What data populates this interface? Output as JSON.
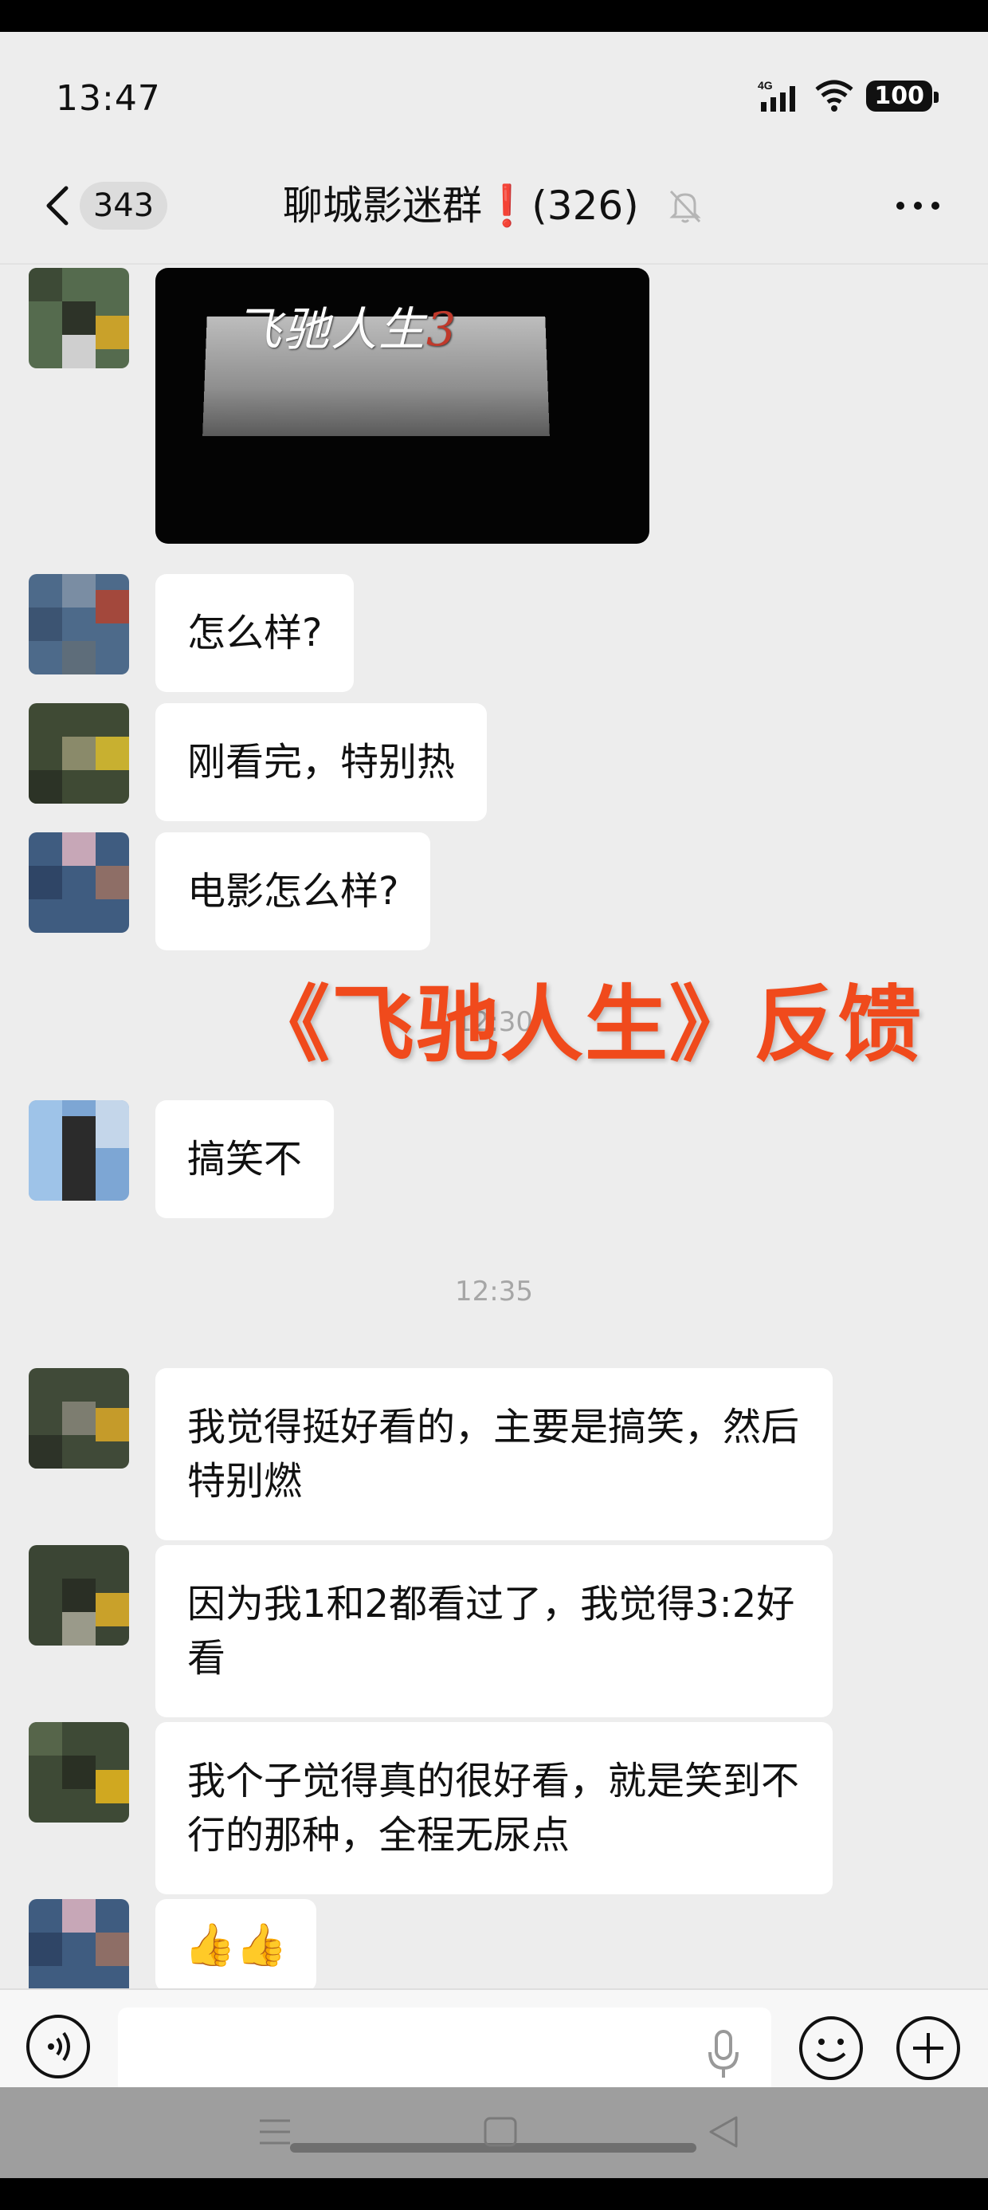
{
  "status_bar": {
    "time": "13:47",
    "network": "4G",
    "battery": "100"
  },
  "header": {
    "unread_count": "343",
    "title": "聊城影迷群❗(326)"
  },
  "image_message": {
    "movie_title": "飞驰人生",
    "movie_number": "3"
  },
  "messages": [
    {
      "text": "怎么样?"
    },
    {
      "text": "刚看完，特别热"
    },
    {
      "text": "电影怎么样?"
    },
    {
      "text": "搞笑不"
    },
    {
      "text": "我觉得挺好看的，主要是搞笑，然后特别燃"
    },
    {
      "text": "因为我1和2都看过了，我觉得3:2好看"
    },
    {
      "text": "我个子觉得真的很好看，就是笑到不行的那种，全程无尿点"
    },
    {
      "text": "👍👍"
    }
  ],
  "timestamps": {
    "obscured": "12:30",
    "second": "12:35"
  },
  "overlay_caption": "《飞驰人生》反馈",
  "input_bar": {
    "placeholder": ""
  },
  "colors": {
    "background": "#ededed",
    "bubble": "#ffffff",
    "caption_accent": "#f04a1c",
    "timestamp": "#a6a6a6",
    "nav_bar": "#9e9e9e"
  },
  "icons": [
    "back-arrow-icon",
    "mute-bell-icon",
    "more-dots-icon",
    "voice-icon",
    "mic-icon",
    "emoji-icon",
    "plus-icon",
    "nav-menu-icon",
    "nav-home-icon",
    "nav-back-icon"
  ]
}
